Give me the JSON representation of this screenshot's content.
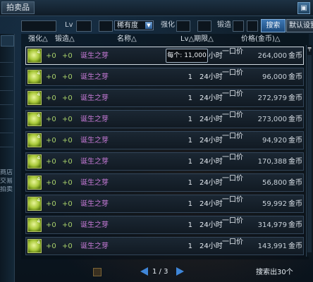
{
  "window": {
    "title": "拍卖品",
    "close_glyph": "▣"
  },
  "filters": {
    "lv_label": "Lv",
    "rarity_select": "稀有度",
    "strengthen_label": "强化",
    "forge_label": "锻造",
    "search_button": "搜索",
    "default_button": "默认设置"
  },
  "left_panel": {
    "items": [
      "商店",
      "交易",
      "拍卖"
    ]
  },
  "table": {
    "headers": {
      "strengthen": "强化△",
      "forge": "锻造△",
      "name": "名称△",
      "level_time": "Lv△期限△",
      "price": "价格(金币)△"
    },
    "tooltip": "每个: 11,000",
    "rows": [
      {
        "strengthen": "+0",
        "forge": "+0",
        "name": "诞生之芽",
        "level": "1",
        "time": "24小时",
        "type": "一口价",
        "price": "264,000",
        "currency": "金币",
        "icon_level": "4"
      },
      {
        "strengthen": "+0",
        "forge": "+0",
        "name": "诞生之芽",
        "level": "1",
        "time": "24小时",
        "type": "一口价",
        "price": "96,000",
        "currency": "金币",
        "icon_level": "4"
      },
      {
        "strengthen": "+0",
        "forge": "+0",
        "name": "诞生之芽",
        "level": "1",
        "time": "24小时",
        "type": "一口价",
        "price": "272,979",
        "currency": "金币",
        "icon_level": "4"
      },
      {
        "strengthen": "+0",
        "forge": "+0",
        "name": "诞生之芽",
        "level": "1",
        "time": "24小时",
        "type": "一口价",
        "price": "273,000",
        "currency": "金币",
        "icon_level": "4"
      },
      {
        "strengthen": "+0",
        "forge": "+0",
        "name": "诞生之芽",
        "level": "1",
        "time": "24小时",
        "type": "一口价",
        "price": "94,920",
        "currency": "金币",
        "icon_level": "4"
      },
      {
        "strengthen": "+0",
        "forge": "+0",
        "name": "诞生之芽",
        "level": "1",
        "time": "24小时",
        "type": "一口价",
        "price": "170,388",
        "currency": "金币",
        "icon_level": "4"
      },
      {
        "strengthen": "+0",
        "forge": "+0",
        "name": "诞生之芽",
        "level": "1",
        "time": "24小时",
        "type": "一口价",
        "price": "56,800",
        "currency": "金币",
        "icon_level": "4"
      },
      {
        "strengthen": "+0",
        "forge": "+0",
        "name": "诞生之芽",
        "level": "1",
        "time": "24小时",
        "type": "一口价",
        "price": "59,992",
        "currency": "金币",
        "icon_level": "4"
      },
      {
        "strengthen": "+0",
        "forge": "+0",
        "name": "诞生之芽",
        "level": "1",
        "time": "24小时",
        "type": "一口价",
        "price": "314,979",
        "currency": "金币",
        "icon_level": "4"
      },
      {
        "strengthen": "+0",
        "forge": "+0",
        "name": "诞生之芽",
        "level": "1",
        "time": "24小时",
        "type": "一口价",
        "price": "143,991",
        "currency": "金币",
        "icon_level": "4"
      }
    ]
  },
  "scroll": {
    "up_glyph": "╤"
  },
  "pager": {
    "page": "1 / 3",
    "result_count": "搜索出30个"
  },
  "colors": {
    "item_name": "#c67ad6",
    "bonus": "#a8d06a",
    "accent": "#3f86d8"
  }
}
